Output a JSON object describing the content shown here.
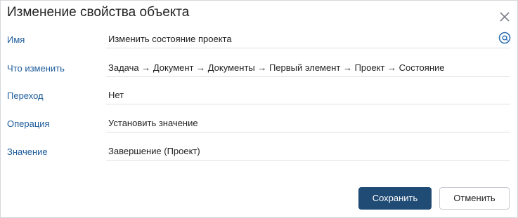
{
  "dialog": {
    "title": "Изменение свойства объекта"
  },
  "fields": [
    {
      "label": "Имя",
      "value": "Изменить состояние проекта",
      "icon": "at-sign-icon"
    },
    {
      "label": "Что изменить",
      "value": "Задача → Документ → Документы → Первый элемент → Проект → Состояние"
    },
    {
      "label": "Переход",
      "value": "Нет"
    },
    {
      "label": "Операция",
      "value": "Установить значение"
    },
    {
      "label": "Значение",
      "value": "Завершение (Проект)"
    }
  ],
  "buttons": {
    "save_label": "Сохранить",
    "cancel_label": "Отменить"
  },
  "colors": {
    "label": "#1d5b9a",
    "primary": "#1f4b74",
    "icon": "#2f6fb3"
  }
}
